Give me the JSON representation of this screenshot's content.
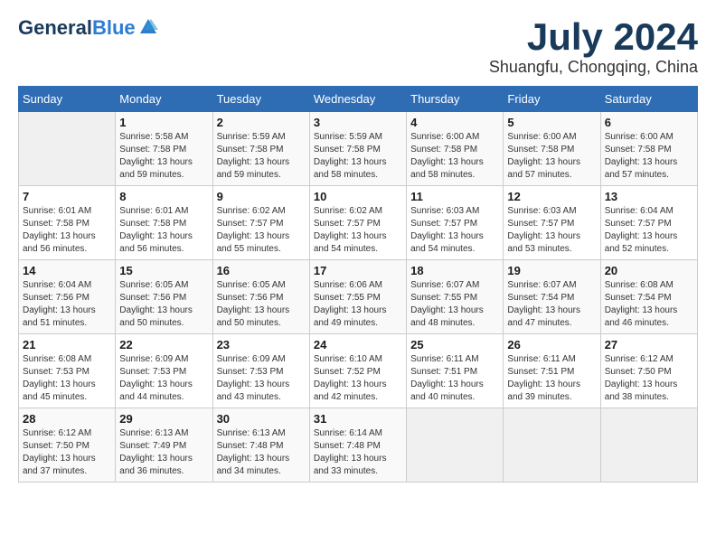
{
  "logo": {
    "general": "General",
    "blue": "Blue",
    "tagline": ""
  },
  "title": "July 2024",
  "subtitle": "Shuangfu, Chongqing, China",
  "headers": [
    "Sunday",
    "Monday",
    "Tuesday",
    "Wednesday",
    "Thursday",
    "Friday",
    "Saturday"
  ],
  "weeks": [
    [
      {
        "num": "",
        "info": ""
      },
      {
        "num": "1",
        "info": "Sunrise: 5:58 AM\nSunset: 7:58 PM\nDaylight: 13 hours\nand 59 minutes."
      },
      {
        "num": "2",
        "info": "Sunrise: 5:59 AM\nSunset: 7:58 PM\nDaylight: 13 hours\nand 59 minutes."
      },
      {
        "num": "3",
        "info": "Sunrise: 5:59 AM\nSunset: 7:58 PM\nDaylight: 13 hours\nand 58 minutes."
      },
      {
        "num": "4",
        "info": "Sunrise: 6:00 AM\nSunset: 7:58 PM\nDaylight: 13 hours\nand 58 minutes."
      },
      {
        "num": "5",
        "info": "Sunrise: 6:00 AM\nSunset: 7:58 PM\nDaylight: 13 hours\nand 57 minutes."
      },
      {
        "num": "6",
        "info": "Sunrise: 6:00 AM\nSunset: 7:58 PM\nDaylight: 13 hours\nand 57 minutes."
      }
    ],
    [
      {
        "num": "7",
        "info": "Sunrise: 6:01 AM\nSunset: 7:58 PM\nDaylight: 13 hours\nand 56 minutes."
      },
      {
        "num": "8",
        "info": "Sunrise: 6:01 AM\nSunset: 7:58 PM\nDaylight: 13 hours\nand 56 minutes."
      },
      {
        "num": "9",
        "info": "Sunrise: 6:02 AM\nSunset: 7:57 PM\nDaylight: 13 hours\nand 55 minutes."
      },
      {
        "num": "10",
        "info": "Sunrise: 6:02 AM\nSunset: 7:57 PM\nDaylight: 13 hours\nand 54 minutes."
      },
      {
        "num": "11",
        "info": "Sunrise: 6:03 AM\nSunset: 7:57 PM\nDaylight: 13 hours\nand 54 minutes."
      },
      {
        "num": "12",
        "info": "Sunrise: 6:03 AM\nSunset: 7:57 PM\nDaylight: 13 hours\nand 53 minutes."
      },
      {
        "num": "13",
        "info": "Sunrise: 6:04 AM\nSunset: 7:57 PM\nDaylight: 13 hours\nand 52 minutes."
      }
    ],
    [
      {
        "num": "14",
        "info": "Sunrise: 6:04 AM\nSunset: 7:56 PM\nDaylight: 13 hours\nand 51 minutes."
      },
      {
        "num": "15",
        "info": "Sunrise: 6:05 AM\nSunset: 7:56 PM\nDaylight: 13 hours\nand 50 minutes."
      },
      {
        "num": "16",
        "info": "Sunrise: 6:05 AM\nSunset: 7:56 PM\nDaylight: 13 hours\nand 50 minutes."
      },
      {
        "num": "17",
        "info": "Sunrise: 6:06 AM\nSunset: 7:55 PM\nDaylight: 13 hours\nand 49 minutes."
      },
      {
        "num": "18",
        "info": "Sunrise: 6:07 AM\nSunset: 7:55 PM\nDaylight: 13 hours\nand 48 minutes."
      },
      {
        "num": "19",
        "info": "Sunrise: 6:07 AM\nSunset: 7:54 PM\nDaylight: 13 hours\nand 47 minutes."
      },
      {
        "num": "20",
        "info": "Sunrise: 6:08 AM\nSunset: 7:54 PM\nDaylight: 13 hours\nand 46 minutes."
      }
    ],
    [
      {
        "num": "21",
        "info": "Sunrise: 6:08 AM\nSunset: 7:53 PM\nDaylight: 13 hours\nand 45 minutes."
      },
      {
        "num": "22",
        "info": "Sunrise: 6:09 AM\nSunset: 7:53 PM\nDaylight: 13 hours\nand 44 minutes."
      },
      {
        "num": "23",
        "info": "Sunrise: 6:09 AM\nSunset: 7:53 PM\nDaylight: 13 hours\nand 43 minutes."
      },
      {
        "num": "24",
        "info": "Sunrise: 6:10 AM\nSunset: 7:52 PM\nDaylight: 13 hours\nand 42 minutes."
      },
      {
        "num": "25",
        "info": "Sunrise: 6:11 AM\nSunset: 7:51 PM\nDaylight: 13 hours\nand 40 minutes."
      },
      {
        "num": "26",
        "info": "Sunrise: 6:11 AM\nSunset: 7:51 PM\nDaylight: 13 hours\nand 39 minutes."
      },
      {
        "num": "27",
        "info": "Sunrise: 6:12 AM\nSunset: 7:50 PM\nDaylight: 13 hours\nand 38 minutes."
      }
    ],
    [
      {
        "num": "28",
        "info": "Sunrise: 6:12 AM\nSunset: 7:50 PM\nDaylight: 13 hours\nand 37 minutes."
      },
      {
        "num": "29",
        "info": "Sunrise: 6:13 AM\nSunset: 7:49 PM\nDaylight: 13 hours\nand 36 minutes."
      },
      {
        "num": "30",
        "info": "Sunrise: 6:13 AM\nSunset: 7:48 PM\nDaylight: 13 hours\nand 34 minutes."
      },
      {
        "num": "31",
        "info": "Sunrise: 6:14 AM\nSunset: 7:48 PM\nDaylight: 13 hours\nand 33 minutes."
      },
      {
        "num": "",
        "info": ""
      },
      {
        "num": "",
        "info": ""
      },
      {
        "num": "",
        "info": ""
      }
    ]
  ]
}
